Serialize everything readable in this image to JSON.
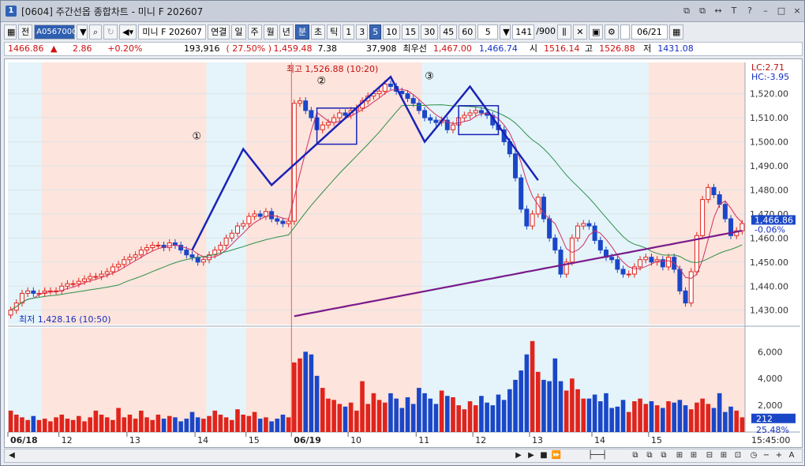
{
  "window": {
    "title": "[0604] 주간선옵 종합차트 - 미니 F 202607",
    "number": "1"
  },
  "title_controls": [
    "⧉",
    "⧉",
    "↔",
    "T",
    "?",
    "–",
    "□",
    "×"
  ],
  "toolbar": {
    "first": "전",
    "code": "A0567000",
    "search_icon": "search-icon",
    "name": "미니 F 202607",
    "period_tabs": [
      "연결",
      "일",
      "주",
      "월",
      "년",
      "분",
      "초",
      "틱"
    ],
    "selected_period": "분",
    "intervals": [
      "1",
      "3",
      "5",
      "10",
      "15",
      "30",
      "45",
      "60"
    ],
    "selected_interval": "5",
    "count_value": "5",
    "position": "141",
    "total": "/900",
    "date": "06/21"
  },
  "quote": {
    "price": "1466.86",
    "change_arrow": "▲",
    "change": "2.86",
    "change_pct": "+0.20%",
    "volume": "193,916",
    "volume_ratio": "( 27.50% )",
    "prev": "1,459.48",
    "diff": "7.38",
    "open_interest": "37,908",
    "best_label": "최우선",
    "best_ask": "1,467.00",
    "best_bid": "1,466.74",
    "open_label": "시",
    "open": "1516.14",
    "high_label": "고",
    "high": "1526.88",
    "low_label": "저",
    "low": "1431.08"
  },
  "annotations": {
    "high_label": "최고 1,526.88 (10:20)",
    "low_label": "최저 1,428.16 (10:50)",
    "wave1": "①",
    "wave2": "②",
    "wave3": "③",
    "lc": "LC:2.71",
    "hc": "HC:-3.95",
    "last_price": "1,466.86",
    "last_pct": "-0.06%",
    "last_vol": "212",
    "vol_pct": "25.48%"
  },
  "chart_data": {
    "type": "candlestick",
    "price_axis": {
      "ticks": [
        "1,520.00",
        "1,510.00",
        "1,500.00",
        "1,490.00",
        "1,480.00",
        "1,470.00",
        "1,460.00",
        "1,450.00",
        "1,440.00",
        "1,430.00"
      ],
      "min": 1424,
      "max": 1533
    },
    "volume_axis": {
      "ticks": [
        "6,000",
        "4,000",
        "2,000"
      ]
    },
    "time_labels": [
      "06/18",
      "12",
      "13",
      "14",
      "15",
      "06/19",
      "10",
      "11",
      "12",
      "13",
      "14",
      "15",
      "15:45:00"
    ],
    "close_series": [
      1430,
      1433,
      1437,
      1438,
      1437,
      1437,
      1438,
      1438,
      1438,
      1440,
      1441,
      1441,
      1442,
      1443,
      1444,
      1444,
      1445,
      1446,
      1448,
      1449,
      1451,
      1452,
      1453,
      1455,
      1456,
      1457,
      1457,
      1456,
      1458,
      1457,
      1455,
      1453,
      1452,
      1450,
      1451,
      1453,
      1455,
      1457,
      1460,
      1462,
      1465,
      1466,
      1469,
      1470,
      1469,
      1471,
      1468,
      1467,
      1466,
      1467,
      1516,
      1517,
      1513,
      1510,
      1505,
      1507,
      1508,
      1510,
      1512,
      1511,
      1513,
      1514,
      1517,
      1519,
      1520,
      1521,
      1524,
      1523,
      1521,
      1520,
      1518,
      1516,
      1513,
      1510,
      1509,
      1508,
      1509,
      1505,
      1507,
      1510,
      1511,
      1512,
      1513,
      1512,
      1511,
      1507,
      1505,
      1500,
      1495,
      1485,
      1472,
      1465,
      1470,
      1477,
      1468,
      1460,
      1455,
      1445,
      1450,
      1460,
      1465,
      1466,
      1465,
      1459,
      1455,
      1452,
      1451,
      1447,
      1445,
      1445,
      1448,
      1451,
      1452,
      1450,
      1451,
      1448,
      1452,
      1447,
      1438,
      1433,
      1446,
      1461,
      1476,
      1481,
      1478,
      1474,
      1468,
      1461,
      1463,
      1466
    ],
    "volume_series": [
      1600,
      1300,
      1100,
      900,
      1200,
      900,
      1000,
      800,
      1100,
      1300,
      1000,
      900,
      1200,
      800,
      1100,
      1600,
      1300,
      1100,
      900,
      1800,
      1100,
      1300,
      1000,
      1600,
      1100,
      900,
      1300,
      1000,
      1200,
      1100,
      800,
      1000,
      1500,
      1100,
      1000,
      1200,
      1600,
      1300,
      1100,
      900,
      1700,
      1300,
      1200,
      1500,
      1000,
      1100,
      800,
      1000,
      1300,
      1100,
      5200,
      5500,
      6000,
      5800,
      4200,
      3300,
      2500,
      2400,
      2100,
      1900,
      2200,
      1600,
      3800,
      2100,
      2900,
      2400,
      2200,
      2900,
      2500,
      1800,
      2600,
      2100,
      3300,
      2900,
      2500,
      2100,
      3100,
      2700,
      2600,
      2000,
      1700,
      2300,
      2000,
      2700,
      2200,
      2000,
      2800,
      2400,
      3200,
      3900,
      4600,
      5800,
      6800,
      4500,
      3900,
      3800,
      5500,
      3800,
      3100,
      4000,
      3200,
      2500,
      2500,
      2800,
      2300,
      2900,
      1800,
      1900,
      2400,
      1500,
      2300,
      2500,
      2100,
      2300,
      2000,
      1800,
      2300,
      2200,
      2400,
      2000,
      1700,
      2200,
      2500,
      2100,
      1800,
      2900,
      1500,
      1900,
      1600,
      1100
    ],
    "session_boundaries_index": [
      50
    ]
  },
  "colors": {
    "up": "#e0241c",
    "down": "#1a47c8",
    "wave": "#1a22b8",
    "ma_long": "#7a1a8a",
    "ma_mid": "#2d8f4a",
    "ma_short": "#d33060",
    "bg_pink": "#fde4dc",
    "bg_cyan": "#e4f4fa"
  }
}
